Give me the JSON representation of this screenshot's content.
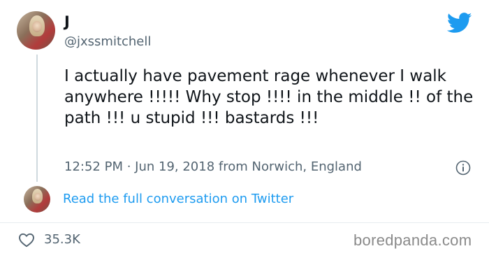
{
  "tweet": {
    "author_name": "J",
    "author_handle": "@jxssmitchell",
    "text": "I actually have pavement rage whenever I walk anywhere !!!!! Why stop !!!! in the middle !! of the path !!! u stupid !!! bastards !!!",
    "meta": "12:52 PM · Jun 19, 2018 from Norwich, England",
    "conversation_link": "Read the full conversation on Twitter",
    "likes": "35.3K"
  },
  "icons": {
    "brand": "twitter-bird-icon",
    "info": "info-icon",
    "like": "heart-icon"
  },
  "colors": {
    "twitter_blue": "#1d9bf0",
    "secondary_text": "#536471"
  },
  "watermark": "boredpanda.com"
}
